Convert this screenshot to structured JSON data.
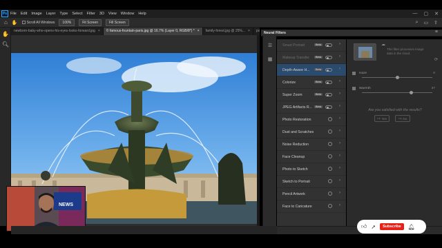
{
  "menubar": {
    "logo": "Ps",
    "items": [
      "File",
      "Edit",
      "Image",
      "Layer",
      "Type",
      "Select",
      "Filter",
      "3D",
      "View",
      "Window",
      "Help"
    ],
    "window_controls": [
      "—",
      "▢",
      "✕"
    ]
  },
  "options_bar": {
    "scroll_all_windows": "Scroll All Windows",
    "zoom_100": "100%",
    "fit_screen": "Fit Screen",
    "fill_screen": "Fill Screen"
  },
  "tabs": [
    {
      "label": "newborn-baby-who-opens-his-eyes-looks-forward.jpg",
      "close": "×",
      "active": false
    },
    {
      "label": "© famous-fountain-paris.jpg @ 16.7% (Layer 0, RGB/8*) *",
      "close": "×",
      "active": true
    },
    {
      "label": "family-forest.jpg @ 25%...",
      "close": "×",
      "active": false
    },
    {
      "label": "portr",
      "close": "",
      "active": false
    }
  ],
  "neural_filters": {
    "title": "Neural Filters",
    "beta_label": "Beta",
    "filters": [
      {
        "name": "Smart Portrait",
        "beta": true,
        "control": "toggle",
        "dim": true,
        "selected": false
      },
      {
        "name": "Makeup Transfer",
        "beta": true,
        "control": "toggle",
        "dim": true,
        "selected": false
      },
      {
        "name": "Depth-Aware H...",
        "beta": true,
        "control": "toggle",
        "dim": false,
        "selected": true
      },
      {
        "name": "Colorize",
        "beta": true,
        "control": "toggle",
        "dim": false,
        "selected": false
      },
      {
        "name": "Super Zoom",
        "beta": true,
        "control": "toggle",
        "dim": false,
        "selected": false
      },
      {
        "name": "JPEG Artifacts R...",
        "beta": true,
        "control": "toggle",
        "dim": false,
        "selected": false
      },
      {
        "name": "Photo Restoration",
        "beta": false,
        "control": "cloud",
        "dim": false,
        "selected": false
      },
      {
        "name": "Dust and Scratches",
        "beta": false,
        "control": "cloud",
        "dim": false,
        "selected": false
      },
      {
        "name": "Noise Reduction",
        "beta": false,
        "control": "cloud",
        "dim": false,
        "selected": false
      },
      {
        "name": "Face Cleanup",
        "beta": false,
        "control": "cloud",
        "dim": false,
        "selected": false
      },
      {
        "name": "Photo to Sketch",
        "beta": false,
        "control": "cloud",
        "dim": false,
        "selected": false
      },
      {
        "name": "Sketch to Portrait",
        "beta": false,
        "control": "cloud",
        "dim": false,
        "selected": false
      },
      {
        "name": "Pencil Artwork",
        "beta": false,
        "control": "cloud",
        "dim": false,
        "selected": false
      },
      {
        "name": "Face to Caricature",
        "beta": false,
        "control": "cloud",
        "dim": false,
        "selected": false
      }
    ]
  },
  "settings": {
    "description": "This filter processes image data in the cloud.",
    "sliders": [
      {
        "label": "Haze",
        "value": "0",
        "fraction": 0.5
      },
      {
        "label": "Warmth",
        "value": "37",
        "fraction": 0.7
      }
    ],
    "satisfied": "Are you satisfied with the results?",
    "yes": "Yes",
    "no": "No"
  },
  "webcam": {
    "badge": "NEWS"
  },
  "subscribe": {
    "label": "Subscribe"
  }
}
